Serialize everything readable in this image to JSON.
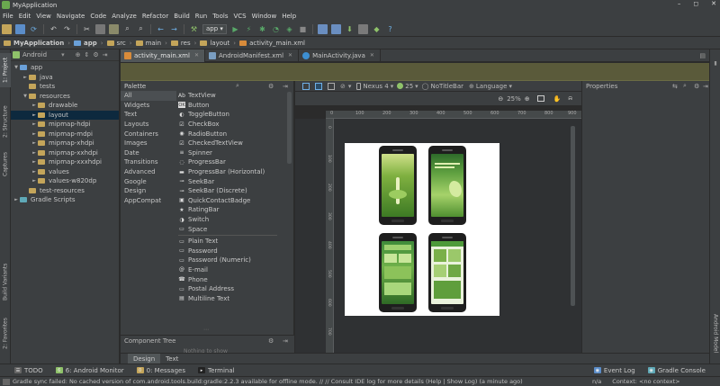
{
  "title_bar": {
    "title": "MyApplication",
    "minimize": "–",
    "maximize": "◻",
    "close": "✕"
  },
  "menu": [
    "File",
    "Edit",
    "View",
    "Navigate",
    "Code",
    "Analyze",
    "Refactor",
    "Build",
    "Run",
    "Tools",
    "VCS",
    "Window",
    "Help"
  ],
  "toolbar": {
    "run_config": "app"
  },
  "breadcrumb": [
    "MyApplication",
    "app",
    "src",
    "main",
    "res",
    "layout",
    "activity_main.xml"
  ],
  "left_strip": {
    "project": "1: Project",
    "structure": "2: Structure",
    "captures": "Captures",
    "build_variants": "Build Variants",
    "favorites": "2: Favorites"
  },
  "right_strip": {
    "android_model": "Android Model"
  },
  "project_panel": {
    "view": "Android",
    "tree": [
      {
        "label": "app",
        "level": 0,
        "arrow": "▼",
        "kind": "module"
      },
      {
        "label": "java",
        "level": 1,
        "arrow": "►",
        "kind": "folder"
      },
      {
        "label": "tests",
        "level": 1,
        "arrow": "",
        "kind": "folder"
      },
      {
        "label": "resources",
        "level": 1,
        "arrow": "▼",
        "kind": "folder"
      },
      {
        "label": "drawable",
        "level": 2,
        "arrow": "►",
        "kind": "folder"
      },
      {
        "label": "layout",
        "level": 2,
        "arrow": "►",
        "kind": "folder",
        "selected": true
      },
      {
        "label": "mipmap-hdpi",
        "level": 2,
        "arrow": "►",
        "kind": "folder"
      },
      {
        "label": "mipmap-mdpi",
        "level": 2,
        "arrow": "►",
        "kind": "folder"
      },
      {
        "label": "mipmap-xhdpi",
        "level": 2,
        "arrow": "►",
        "kind": "folder"
      },
      {
        "label": "mipmap-xxhdpi",
        "level": 2,
        "arrow": "►",
        "kind": "folder"
      },
      {
        "label": "mipmap-xxxhdpi",
        "level": 2,
        "arrow": "►",
        "kind": "folder"
      },
      {
        "label": "values",
        "level": 2,
        "arrow": "►",
        "kind": "folder"
      },
      {
        "label": "values-w820dp",
        "level": 2,
        "arrow": "►",
        "kind": "folder"
      },
      {
        "label": "test-resources",
        "level": 1,
        "arrow": "",
        "kind": "folder"
      },
      {
        "label": "Gradle Scripts",
        "level": 0,
        "arrow": "►",
        "kind": "gradle"
      }
    ]
  },
  "editor_tabs": [
    {
      "label": "activity_main.xml",
      "active": true,
      "color": "#d88b3a"
    },
    {
      "label": "AndroidManifest.xml",
      "active": false,
      "color": "#7a9ec2"
    },
    {
      "label": "MainActivity.java",
      "active": false,
      "color": "#3d8fd1"
    }
  ],
  "palette": {
    "title": "Palette",
    "categories": [
      "All",
      "Widgets",
      "Text",
      "Layouts",
      "Containers",
      "Images",
      "Date",
      "Transitions",
      "Advanced",
      "Google",
      "Design",
      "AppCompat"
    ],
    "widgets_group1": [
      {
        "icon": "Ab",
        "label": "TextView"
      },
      {
        "icon": "OK",
        "label": "Button"
      },
      {
        "icon": "◐",
        "label": "ToggleButton"
      },
      {
        "icon": "☑",
        "label": "CheckBox"
      },
      {
        "icon": "◉",
        "label": "RadioButton"
      },
      {
        "icon": "☑",
        "label": "CheckedTextView"
      },
      {
        "icon": "≡",
        "label": "Spinner"
      },
      {
        "icon": "◌",
        "label": "ProgressBar"
      },
      {
        "icon": "▬",
        "label": "ProgressBar (Horizontal)"
      },
      {
        "icon": "⊸",
        "label": "SeekBar"
      },
      {
        "icon": "⊸",
        "label": "SeekBar (Discrete)"
      },
      {
        "icon": "▣",
        "label": "QuickContactBadge"
      },
      {
        "icon": "★",
        "label": "RatingBar"
      },
      {
        "icon": "◑",
        "label": "Switch"
      },
      {
        "icon": "▭",
        "label": "Space"
      }
    ],
    "widgets_group2": [
      {
        "icon": "▭",
        "label": "Plain Text"
      },
      {
        "icon": "▭",
        "label": "Password"
      },
      {
        "icon": "▭",
        "label": "Password (Numeric)"
      },
      {
        "icon": "@",
        "label": "E-mail"
      },
      {
        "icon": "☎",
        "label": "Phone"
      },
      {
        "icon": "▭",
        "label": "Postal Address"
      },
      {
        "icon": "▤",
        "label": "Multiline Text"
      }
    ]
  },
  "component_tree": {
    "title": "Component Tree",
    "empty": "Nothing to show"
  },
  "design_toolbar": {
    "device": "Nexus 4",
    "api": "25",
    "theme": "NoTitleBar",
    "language": "Language",
    "zoom": "25%"
  },
  "ruler_ticks": [
    "0",
    "100",
    "200",
    "300",
    "400",
    "500",
    "600",
    "700",
    "800",
    "900"
  ],
  "vruler_ticks": [
    "0",
    "100",
    "200",
    "300",
    "400",
    "500",
    "600",
    "700"
  ],
  "properties": {
    "title": "Properties"
  },
  "design_tabs": [
    "Design",
    "Text"
  ],
  "bottom_tools": [
    {
      "icon": "☰",
      "label": "TODO"
    },
    {
      "icon": "6",
      "label": "6: Android Monitor"
    },
    {
      "icon": "0",
      "label": "0: Messages"
    },
    {
      "icon": "▸",
      "label": "Terminal"
    }
  ],
  "bottom_tools_right": [
    {
      "icon": "◉",
      "label": "Event Log"
    },
    {
      "icon": "◉",
      "label": "Gradle Console"
    }
  ],
  "status": {
    "message": "Gradle sync failed: No cached version of com.android.tools.build:gradle:2.2.3 available for offline mode. // // Consult IDE log for more details (Help | Show Log) (a minute ago)",
    "position": "n/a",
    "context": "Context: <no context>"
  }
}
